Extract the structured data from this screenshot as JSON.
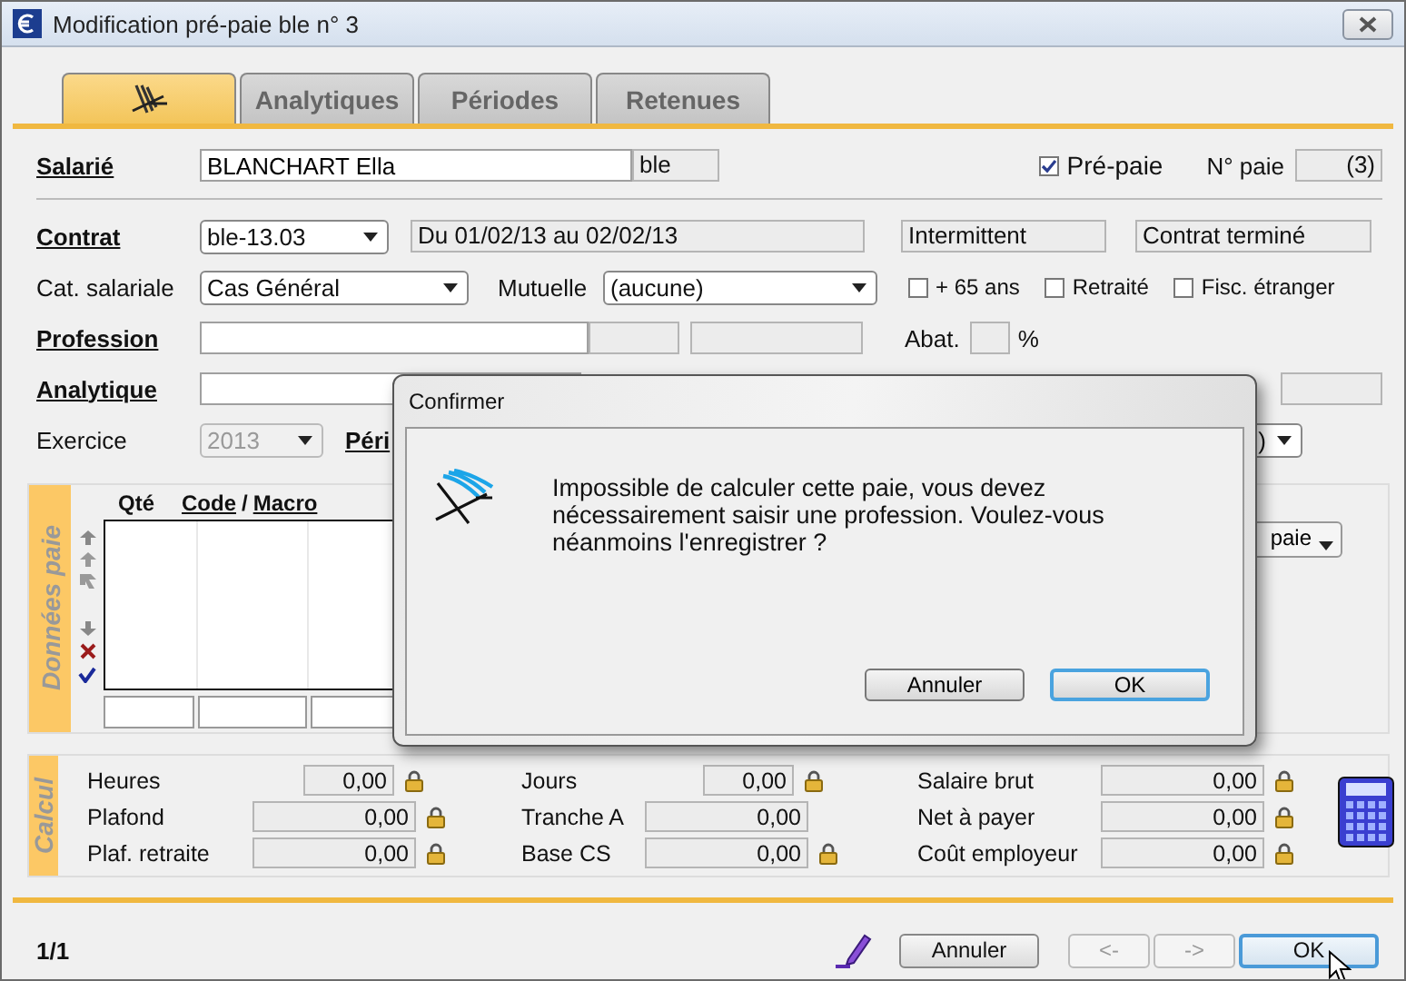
{
  "window": {
    "title": "Modification pré-paie ble n° 3"
  },
  "tabs": [
    {
      "kind": "icon",
      "selected": true
    },
    {
      "kind": "text",
      "label": "Analytiques",
      "selected": false
    },
    {
      "kind": "text",
      "label": "Périodes",
      "selected": false
    },
    {
      "kind": "text",
      "label": "Retenues",
      "selected": false
    }
  ],
  "salarie": {
    "label": "Salarié",
    "value": "BLANCHART Ella",
    "code": "ble",
    "prepaie": {
      "label": "Pré-paie",
      "checked": true
    },
    "no_paie": {
      "label": "N° paie",
      "value": "(3)"
    }
  },
  "contrat": {
    "label": "Contrat",
    "value": "ble-13.03",
    "dates": "Du 01/02/13 au 02/02/13",
    "type": "Intermittent",
    "status": "Contrat terminé"
  },
  "categorie": {
    "label": "Cat. salariale",
    "value": "Cas Général"
  },
  "mutuelle": {
    "label": "Mutuelle",
    "value": "(aucune)"
  },
  "options": [
    {
      "label": "+ 65 ans",
      "checked": false
    },
    {
      "label": "Retraité",
      "checked": false
    },
    {
      "label": "Fisc. étranger",
      "checked": false
    }
  ],
  "profession": {
    "label": "Profession"
  },
  "abat": {
    "label": "Abat.",
    "unit": "%"
  },
  "analytique": {
    "label": "Analytique"
  },
  "exercice": {
    "label": "Exercice",
    "value": "2013",
    "disabled": true
  },
  "periode": {
    "label": "Péri",
    "value": ")"
  },
  "donnees": {
    "title": "Données paie",
    "qty_header": "Qté",
    "code_header": "Code",
    "separator": "/",
    "macro_header": "Macro",
    "menu_button": "paie"
  },
  "calcul": {
    "title": "Calcul",
    "columns": [
      [
        {
          "label": "Heures",
          "value": "0,00",
          "locked": true
        },
        {
          "label": "Plafond",
          "value": "0,00",
          "locked": true
        },
        {
          "label": "Plaf. retraite",
          "value": "0,00",
          "locked": true
        }
      ],
      [
        {
          "label": "Jours",
          "value": "0,00",
          "locked": true
        },
        {
          "label": "Tranche A",
          "value": "0,00",
          "locked": false
        },
        {
          "label": "Base CS",
          "value": "0,00",
          "locked": true
        }
      ],
      [
        {
          "label": "Salaire brut",
          "value": "0,00",
          "locked": true
        },
        {
          "label": "Net à payer",
          "value": "0,00",
          "locked": true
        },
        {
          "label": "Coût employeur",
          "value": "0,00",
          "locked": true
        }
      ]
    ]
  },
  "footer": {
    "page": "1/1",
    "buttons": [
      {
        "label": "Annuler",
        "disabled": false,
        "default": false
      },
      {
        "label": "<-",
        "disabled": true,
        "default": false
      },
      {
        "label": "->",
        "disabled": true,
        "default": false
      },
      {
        "label": "OK",
        "disabled": false,
        "default": true
      }
    ]
  },
  "dialog": {
    "title": "Confirmer",
    "message": "Impossible de calculer cette paie, vous devez nécessairement saisir une profession. Voulez-vous néanmoins l'enregistrer ?",
    "buttons": [
      {
        "label": "Annuler",
        "default": false
      },
      {
        "label": "OK",
        "default": true
      }
    ]
  }
}
